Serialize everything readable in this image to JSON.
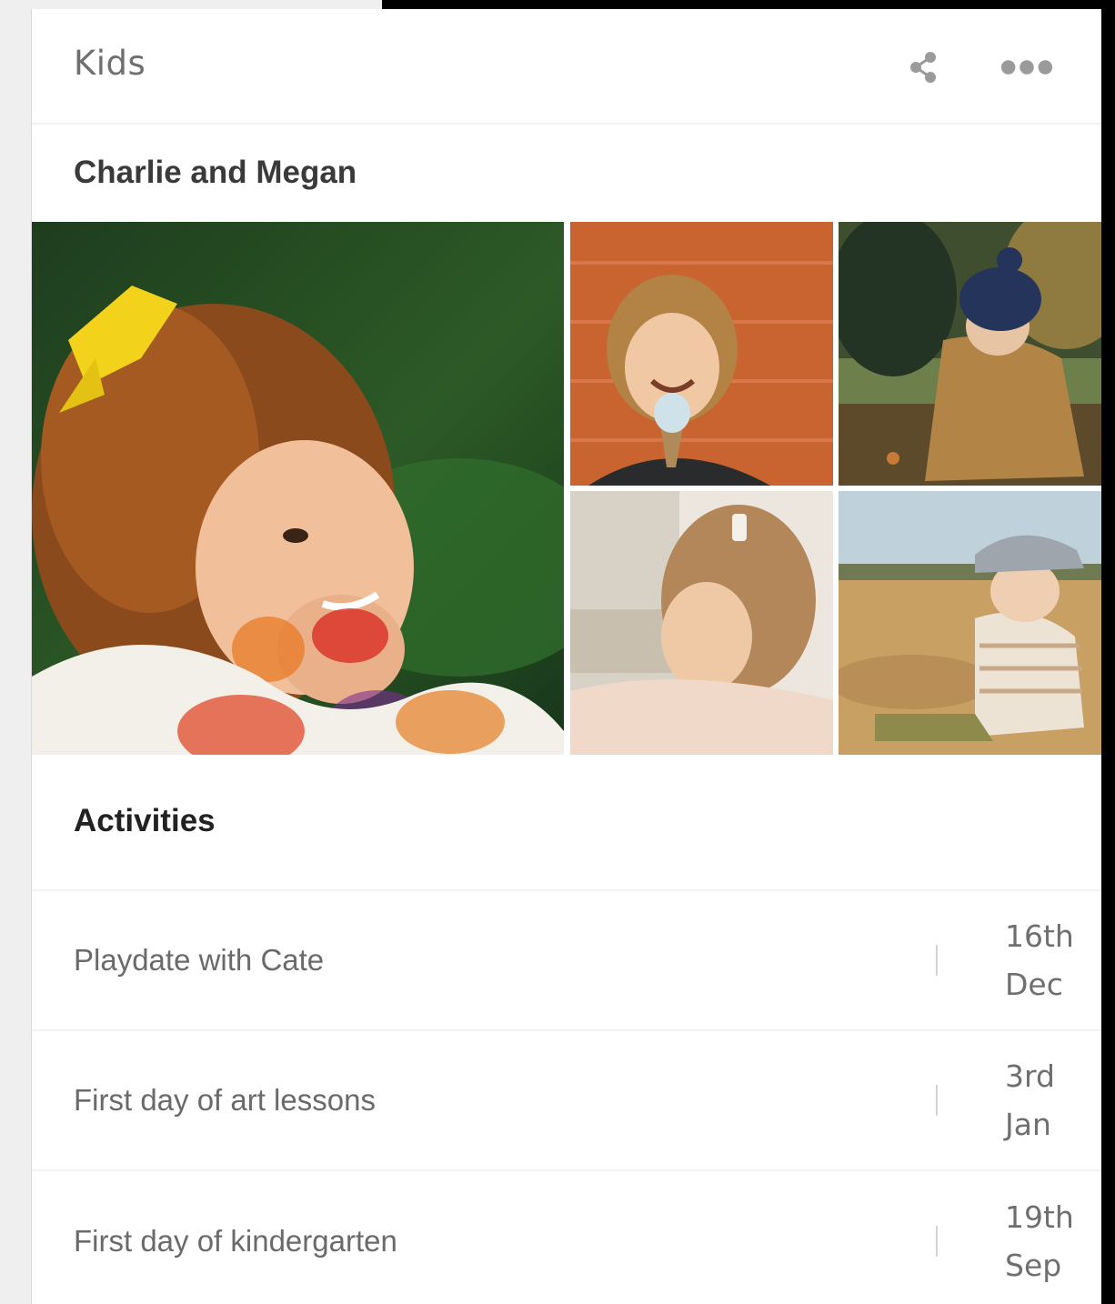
{
  "card": {
    "title": "Kids",
    "share_icon": "share-icon",
    "more_icon": "more-horizontal-icon"
  },
  "album": {
    "title": "Charlie and Megan",
    "photos": [
      "girl-with-face-paint-and-yellow-bow",
      "boy-with-ice-cream-orange-wall",
      "toddler-in-blue-hat-and-jacket",
      "girl-with-hair-clip-at-table",
      "baby-in-cap-sitting-on-sand"
    ]
  },
  "activities": {
    "title": "Activities",
    "items": [
      {
        "name": "Playdate with Cate",
        "day": "16th",
        "month": "Dec"
      },
      {
        "name": "First day of art lessons",
        "day": "3rd",
        "month": "Jan"
      },
      {
        "name": "First day of kindergarten",
        "day": "19th",
        "month": "Sep"
      }
    ]
  },
  "colors": {
    "background": "#000000",
    "side_panel": "#efefef",
    "card": "#ffffff",
    "title_text": "#6f6f6f",
    "heading_text": "#3a3a3a",
    "divider": "#f3f3f3"
  }
}
